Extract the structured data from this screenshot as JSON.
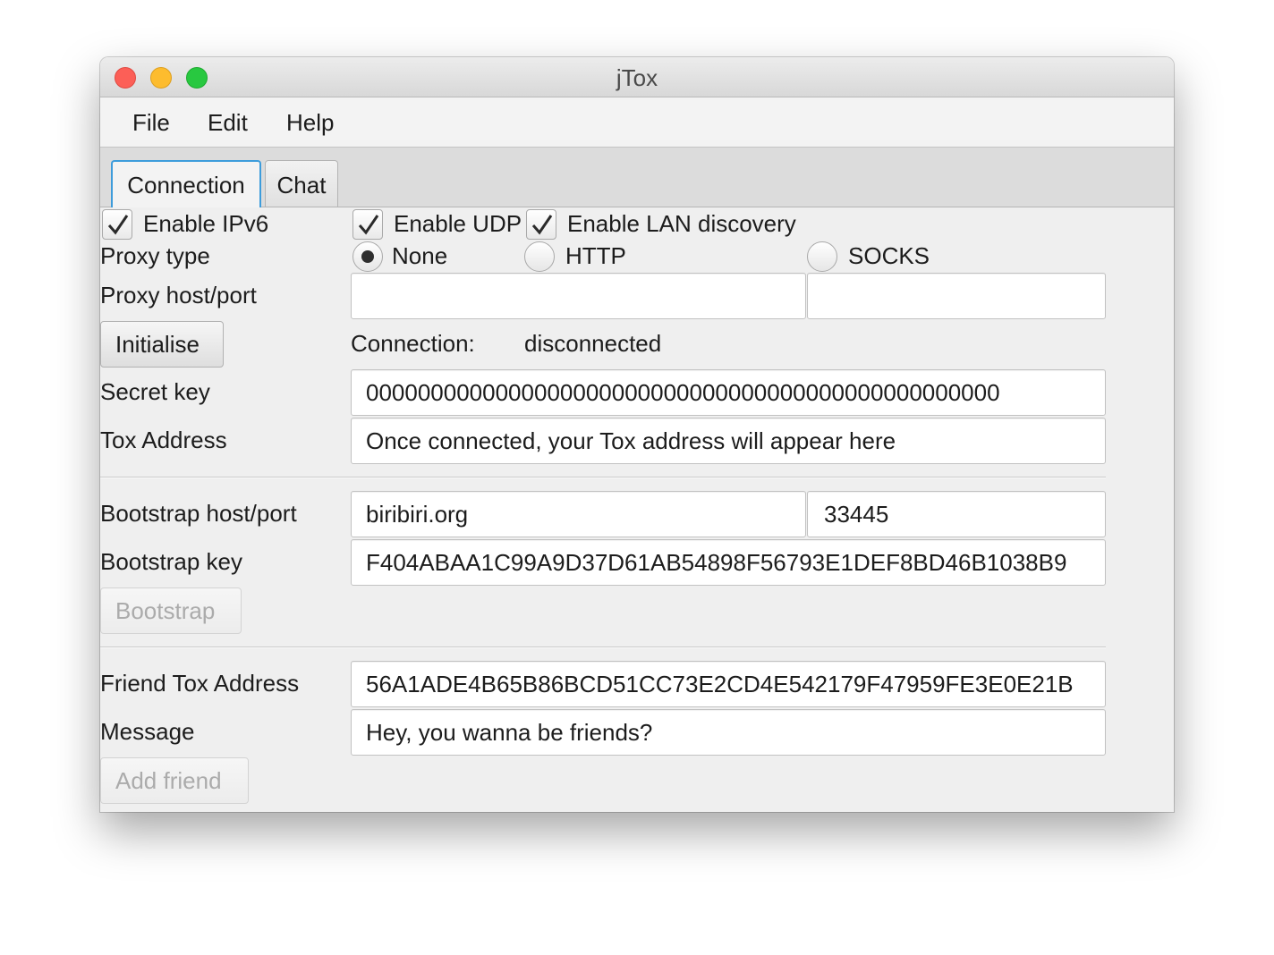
{
  "window": {
    "title": "jTox"
  },
  "menu": {
    "items": [
      "File",
      "Edit",
      "Help"
    ]
  },
  "tabs": [
    {
      "label": "Connection",
      "active": true
    },
    {
      "label": "Chat",
      "active": false
    }
  ],
  "options": {
    "ipv6": {
      "label": "Enable IPv6",
      "checked": true
    },
    "udp": {
      "label": "Enable UDP",
      "checked": true
    },
    "lan": {
      "label": "Enable LAN discovery",
      "checked": true
    }
  },
  "proxy": {
    "type_label": "Proxy type",
    "options": [
      {
        "label": "None",
        "selected": true
      },
      {
        "label": "HTTP",
        "selected": false
      },
      {
        "label": "SOCKS",
        "selected": false
      }
    ],
    "host_port_label": "Proxy host/port",
    "host_value": "",
    "port_value": ""
  },
  "connection": {
    "initialise_label": "Initialise",
    "status_label": "Connection:",
    "status_value": "disconnected",
    "secret_key_label": "Secret key",
    "secret_key_value": "0000000000000000000000000000000000000000000000000",
    "tox_address_label": "Tox Address",
    "tox_address_value": "Once connected, your Tox address will appear here"
  },
  "bootstrap": {
    "host_port_label": "Bootstrap host/port",
    "host_value": "biribiri.org",
    "port_value": "33445",
    "key_label": "Bootstrap key",
    "key_value": "F404ABAA1C99A9D37D61AB54898F56793E1DEF8BD46B1038B9",
    "button_label": "Bootstrap",
    "button_enabled": false
  },
  "friend": {
    "address_label": "Friend Tox Address",
    "address_value": "56A1ADE4B65B86BCD51CC73E2CD4E542179F47959FE3E0E21B",
    "message_label": "Message",
    "message_value": "Hey, you wanna be friends?",
    "button_label": "Add friend",
    "button_enabled": false
  },
  "colors": {
    "close": "#fc5f57",
    "minimize": "#fdbc2e",
    "maximize": "#28c840",
    "focus_ring": "#3d9cdb",
    "window_bg": "#efefef"
  }
}
